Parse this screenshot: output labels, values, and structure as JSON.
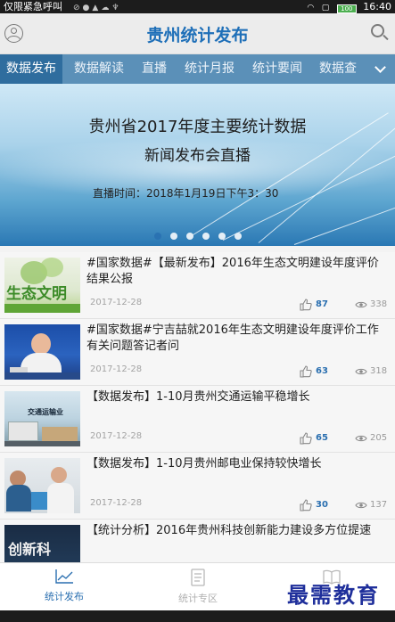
{
  "status_bar": {
    "carrier": "仅限紧急呼叫",
    "battery": "100",
    "time": "16:40"
  },
  "header": {
    "title": "贵州统计发布"
  },
  "tabs": [
    "数据发布",
    "数据解读",
    "直播",
    "统计月报",
    "统计要闻",
    "数据查"
  ],
  "banner": {
    "line1": "贵州省2017年度主要统计数据",
    "line2": "新闻发布会直播",
    "line3": "直播时间：2018年1月19日下午3：30",
    "dots": 6,
    "active_dot": 0
  },
  "articles": [
    {
      "title": "#国家数据#【最新发布】2016年生态文明建设年度评价结果公报",
      "date": "2017-12-28",
      "likes": "87",
      "views": "338",
      "thumb_text": "生态文明"
    },
    {
      "title": "#国家数据#宁吉喆就2016年生态文明建设年度评价工作有关问题答记者问",
      "date": "2017-12-28",
      "likes": "63",
      "views": "318",
      "thumb_text": ""
    },
    {
      "title": "【数据发布】1-10月贵州交通运输平稳增长",
      "date": "2017-12-28",
      "likes": "65",
      "views": "205",
      "thumb_text": "交通运输业"
    },
    {
      "title": "【数据发布】1-10月贵州邮电业保持较快增长",
      "date": "2017-12-28",
      "likes": "30",
      "views": "137",
      "thumb_text": ""
    },
    {
      "title": "【统计分析】2016年贵州科技创新能力建设多方位提速",
      "date": "",
      "likes": "",
      "views": "",
      "thumb_text": "创新科"
    }
  ],
  "bottom_nav": [
    {
      "label": "统计发布",
      "active": true
    },
    {
      "label": "统计专区",
      "active": false
    }
  ],
  "watermark": "最需教育",
  "colors": {
    "brand_blue": "#1e6fb8",
    "tab_bar": "#5b90b8",
    "tab_active": "#2f6d9e"
  }
}
